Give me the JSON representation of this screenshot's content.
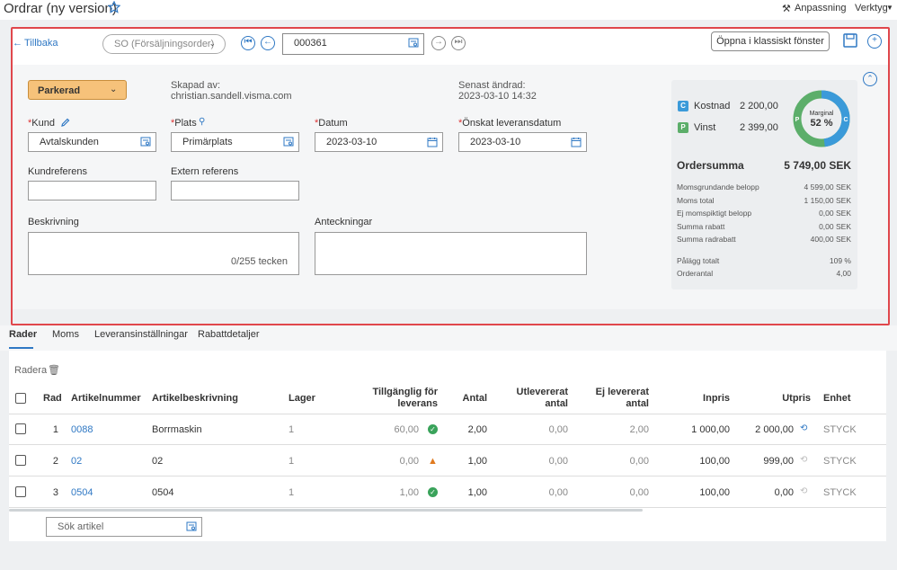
{
  "header": {
    "title": "Ordrar (ny version)",
    "customize_label": "Anpassning",
    "tools_label": "Verktyg"
  },
  "toolbar": {
    "back_label": "Tillbaka",
    "order_type": "SO (Försäljningsorder)",
    "order_number": "000361",
    "classic_window_label": "Öppna i klassiskt fönster"
  },
  "order": {
    "status": "Parkerad",
    "created_by_label": "Skapad av:",
    "created_by_value": "christian.sandell.visma.com",
    "last_changed_label": "Senast ändrad:",
    "last_changed_value": "2023-03-10 14:32",
    "customer_label": "Kund",
    "customer_value": "Avtalskunden",
    "location_label": "Plats",
    "location_value": "Primärplats",
    "date_label": "Datum",
    "date_value": "2023-03-10",
    "delivery_date_label": "Önskat leveransdatum",
    "delivery_date_value": "2023-03-10",
    "customer_ref_label": "Kundreferens",
    "external_ref_label": "Extern referens",
    "description_label": "Beskrivning",
    "char_counter": "0/255 tecken",
    "notes_label": "Anteckningar"
  },
  "summary": {
    "cost_badge": "C",
    "cost_label": "Kostnad",
    "cost_value": "2 200,00",
    "profit_badge": "P",
    "profit_label": "Vinst",
    "profit_value": "2 399,00",
    "margin_label": "Marginal",
    "margin_value": "52 %",
    "margin_fraction": 0.52,
    "order_sum_label": "Ordersumma",
    "order_sum_value": "5 749,00 SEK",
    "rows": [
      {
        "label": "Momsgrundande belopp",
        "value": "4 599,00 SEK"
      },
      {
        "label": "Moms total",
        "value": "1 150,00 SEK"
      },
      {
        "label": "Ej momspiktigt belopp",
        "value": "0,00 SEK"
      },
      {
        "label": "Summa rabatt",
        "value": "0,00 SEK"
      },
      {
        "label": "Summa radrabatt",
        "value": "400,00 SEK"
      }
    ],
    "rows2": [
      {
        "label": "Pålägg totalt",
        "value": "109 %"
      },
      {
        "label": "Orderantal",
        "value": "4,00"
      }
    ],
    "colors": {
      "cost": "#3b9ad9",
      "profit": "#5cae6a"
    }
  },
  "tabs": [
    "Rader",
    "Moms",
    "Leveransinställningar",
    "Rabattdetaljer"
  ],
  "grid": {
    "delete_label": "Radera",
    "columns": [
      "Rad",
      "Artikelnummer",
      "Artikelbeskrivning",
      "Lager",
      "Tillgänglig för",
      "leverans",
      "Antal",
      "Utlevererat",
      "antal",
      "Ej levererat",
      "antal",
      "Inpris",
      "Utpris",
      "Enhet"
    ],
    "rows": [
      {
        "rad": "1",
        "artnr": "0088",
        "desc": "Borrmaskin",
        "lager": "1",
        "avail": "60,00",
        "antal": "2,00",
        "utlev": "0,00",
        "ejlev": "2,00",
        "inpris": "1 000,00",
        "utpris": "2 000,00",
        "enhet": "STYCK"
      },
      {
        "rad": "2",
        "artnr": "02",
        "desc": "02",
        "lager": "1",
        "avail": "0,00",
        "antal": "1,00",
        "utlev": "0,00",
        "ejlev": "0,00",
        "inpris": "100,00",
        "utpris": "999,00",
        "enhet": "STYCK"
      },
      {
        "rad": "3",
        "artnr": "0504",
        "desc": "0504",
        "lager": "1",
        "avail": "1,00",
        "antal": "1,00",
        "utlev": "0,00",
        "ejlev": "0,00",
        "inpris": "100,00",
        "utpris": "0,00",
        "enhet": "STYCK"
      }
    ],
    "search_placeholder": "Sök artikel"
  }
}
